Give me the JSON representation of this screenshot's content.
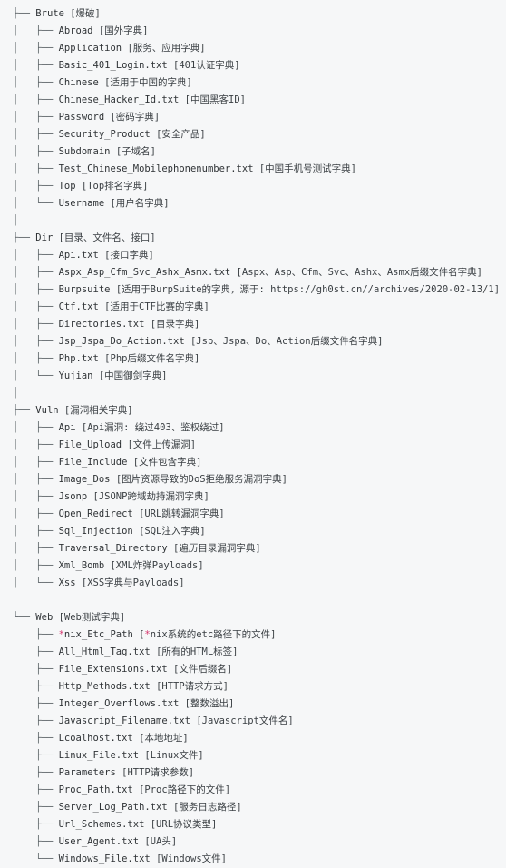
{
  "view": {
    "kind": "ascii-tree-listing",
    "background_color": "#f6f7f8",
    "text_color": "#34383c",
    "accent_color": "#d6336c",
    "indent_unit": "    ",
    "branch_mid": "├── ",
    "branch_last": "└── ",
    "pipe": "│   ",
    "space": "    "
  },
  "tree": [
    {
      "prefix": "├── ",
      "name": "Brute",
      "desc": "[爆破]",
      "children": [
        {
          "prefix": "│   ├── ",
          "name": "Abroad",
          "desc": "[国外字典]"
        },
        {
          "prefix": "│   ├── ",
          "name": "Application",
          "desc": "[服务、应用字典]"
        },
        {
          "prefix": "│   ├── ",
          "name": "Basic_401_Login.txt",
          "desc": "[401认证字典]"
        },
        {
          "prefix": "│   ├── ",
          "name": "Chinese",
          "desc": "[适用于中国的字典]"
        },
        {
          "prefix": "│   ├── ",
          "name": "Chinese_Hacker_Id.txt",
          "desc": "[中国黑客ID]"
        },
        {
          "prefix": "│   ├── ",
          "name": "Password",
          "desc": "[密码字典]"
        },
        {
          "prefix": "│   ├── ",
          "name": "Security_Product",
          "desc": "[安全产品]"
        },
        {
          "prefix": "│   ├── ",
          "name": "Subdomain",
          "desc": "[子域名]"
        },
        {
          "prefix": "│   ├── ",
          "name": "Test_Chinese_Mobilephonenumber.txt",
          "desc": "[中国手机号测试字典]"
        },
        {
          "prefix": "│   ├── ",
          "name": "Top",
          "desc": "[Top排名字典]"
        },
        {
          "prefix": "│   └── ",
          "name": "Username",
          "desc": "[用户名字典]"
        }
      ],
      "trailing_blank": "│"
    },
    {
      "prefix": "├── ",
      "name": "Dir",
      "desc": "[目录、文件名、接口]",
      "children": [
        {
          "prefix": "│   ├── ",
          "name": "Api.txt",
          "desc": "[接口字典]"
        },
        {
          "prefix": "│   ├── ",
          "name": "Aspx_Asp_Cfm_Svc_Ashx_Asmx.txt",
          "desc": "[Aspx、Asp、Cfm、Svc、Ashx、Asmx后缀文件名字典]"
        },
        {
          "prefix": "│   ├── ",
          "name": "Burpsuite",
          "desc": "[适用于BurpSuite的字典，源于: https://gh0st.cn//archives/2020-02-13/1]"
        },
        {
          "prefix": "│   ├── ",
          "name": "Ctf.txt",
          "desc": "[适用于CTF比赛的字典]"
        },
        {
          "prefix": "│   ├── ",
          "name": "Directories.txt",
          "desc": "[目录字典]"
        },
        {
          "prefix": "│   ├── ",
          "name": "Jsp_Jspa_Do_Action.txt",
          "desc": "[Jsp、Jspa、Do、Action后缀文件名字典]"
        },
        {
          "prefix": "│   ├── ",
          "name": "Php.txt",
          "desc": "[Php后缀文件名字典]"
        },
        {
          "prefix": "│   └── ",
          "name": "Yujian",
          "desc": "[中国御剑字典]"
        }
      ],
      "trailing_blank": "│"
    },
    {
      "prefix": "├── ",
      "name": "Vuln",
      "desc": "[漏洞相关字典]",
      "children": [
        {
          "prefix": "│   ├── ",
          "name": "Api",
          "desc": "[Api漏洞: 绕过403、鉴权绕过]"
        },
        {
          "prefix": "│   ├── ",
          "name": "File_Upload",
          "desc": "[文件上传漏洞]"
        },
        {
          "prefix": "│   ├── ",
          "name": "File_Include",
          "desc": "[文件包含字典]"
        },
        {
          "prefix": "│   ├── ",
          "name": "Image_Dos",
          "desc": "[图片资源导致的DoS拒绝服务漏洞字典]"
        },
        {
          "prefix": "│   ├── ",
          "name": "Jsonp",
          "desc": "[JSONP跨域劫持漏洞字典]"
        },
        {
          "prefix": "│   ├── ",
          "name": "Open_Redirect",
          "desc": "[URL跳转漏洞字典]"
        },
        {
          "prefix": "│   ├── ",
          "name": "Sql_Injection",
          "desc": "[SQL注入字典]"
        },
        {
          "prefix": "│   ├── ",
          "name": "Traversal_Directory",
          "desc": "[遍历目录漏洞字典]"
        },
        {
          "prefix": "│   ├── ",
          "name": "Xml_Bomb",
          "desc": "[XML炸弹Payloads]"
        },
        {
          "prefix": "│   └── ",
          "name": "Xss",
          "desc": "[XSS字典与Payloads]"
        }
      ],
      "trailing_blank": ""
    },
    {
      "prefix": "└── ",
      "name": "Web",
      "desc": "[Web测试字典]",
      "children": [
        {
          "prefix": "    ├── ",
          "name": "*nix_Etc_Path",
          "desc": "[*nix系统的etc路径下的文件]",
          "emphasis": true
        },
        {
          "prefix": "    ├── ",
          "name": "All_Html_Tag.txt",
          "desc": "[所有的HTML标签]"
        },
        {
          "prefix": "    ├── ",
          "name": "File_Extensions.txt",
          "desc": "[文件后缀名]"
        },
        {
          "prefix": "    ├── ",
          "name": "Http_Methods.txt",
          "desc": "[HTTP请求方式]"
        },
        {
          "prefix": "    ├── ",
          "name": "Integer_Overflows.txt",
          "desc": "[整数溢出]"
        },
        {
          "prefix": "    ├── ",
          "name": "Javascript_Filename.txt",
          "desc": "[Javascript文件名]"
        },
        {
          "prefix": "    ├── ",
          "name": "Lcoalhost.txt",
          "desc": "[本地地址]"
        },
        {
          "prefix": "    ├── ",
          "name": "Linux_File.txt",
          "desc": "[Linux文件]"
        },
        {
          "prefix": "    ├── ",
          "name": "Parameters",
          "desc": "[HTTP请求参数]"
        },
        {
          "prefix": "    ├── ",
          "name": "Proc_Path.txt",
          "desc": "[Proc路径下的文件]"
        },
        {
          "prefix": "    ├── ",
          "name": "Server_Log_Path.txt",
          "desc": "[服务日志路径]"
        },
        {
          "prefix": "    ├── ",
          "name": "Url_Schemes.txt",
          "desc": "[URL协议类型]"
        },
        {
          "prefix": "    ├── ",
          "name": "User_Agent.txt",
          "desc": "[UA头]"
        },
        {
          "prefix": "    └── ",
          "name": "Windows_File.txt",
          "desc": "[Windows文件]"
        }
      ],
      "trailing_blank": ""
    }
  ]
}
